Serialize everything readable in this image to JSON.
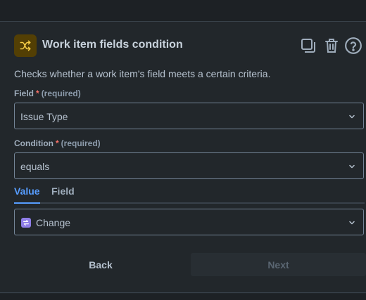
{
  "panel": {
    "title": "Work item fields condition",
    "description": "Checks whether a work item's field meets a certain criteria.",
    "icons": {
      "component": "shuffle-icon",
      "duplicate": "duplicate-icon",
      "delete": "trash-icon",
      "help": "help-icon"
    }
  },
  "field": {
    "label": "Field",
    "required_marker": "*",
    "required_text": "(required)",
    "value": "Issue Type"
  },
  "condition": {
    "label": "Condition",
    "required_marker": "*",
    "required_text": "(required)",
    "value": "equals"
  },
  "tabs": [
    {
      "label": "Value",
      "active": true
    },
    {
      "label": "Field",
      "active": false
    }
  ],
  "value_select": {
    "value": "Change",
    "icon": "change-type-icon"
  },
  "actions": {
    "back_label": "Back",
    "next_label": "Next"
  },
  "colors": {
    "accent": "#579dff",
    "required": "#f87168",
    "component_icon_bg": "#533f04",
    "component_icon_fg": "#f5cd47",
    "change_badge": "#8f7ee7"
  }
}
